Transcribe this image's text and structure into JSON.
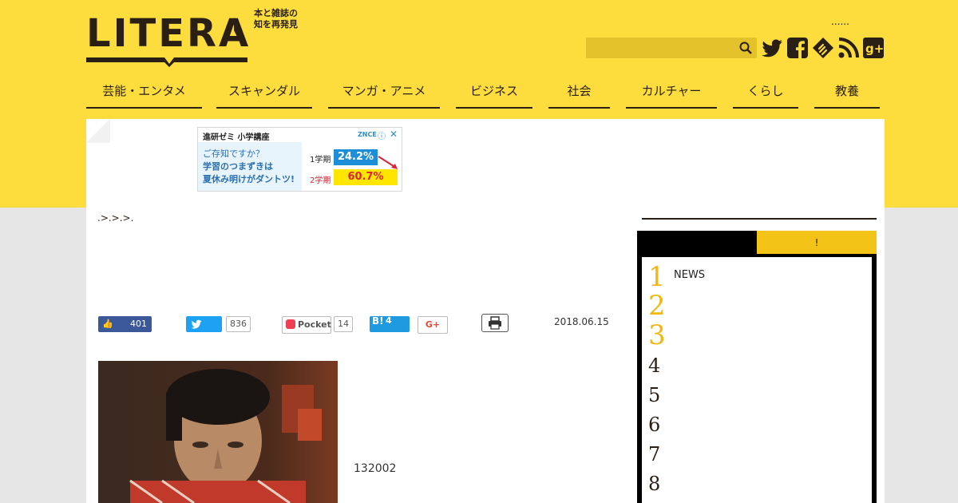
{
  "header": {
    "logo_text": "LITERA",
    "tagline_line1": "本と雑誌の",
    "tagline_line2": "知を再発見",
    "dots": "......",
    "search": {
      "placeholder": ""
    },
    "social_icons": [
      "twitter-icon",
      "facebook-icon",
      "feedly-icon",
      "rss-icon",
      "google-plus-icon"
    ]
  },
  "nav": [
    {
      "label": "芸能・エンタメ"
    },
    {
      "label": "スキャンダル"
    },
    {
      "label": "マンガ・アニメ"
    },
    {
      "label": "ビジネス"
    },
    {
      "label": "社会"
    },
    {
      "label": "カルチャー"
    },
    {
      "label": "くらし"
    },
    {
      "label": "教養"
    }
  ],
  "ad": {
    "title": "進研ゼミ 小学講座",
    "line1": "ご存知ですか？",
    "line2": "学習のつまずきは",
    "line3": "夏休み明けがダントツ!",
    "term1": "1学期",
    "value1": "24.2%",
    "term2": "2学期",
    "value2": "60.7%",
    "brand": "ZNCE"
  },
  "breadcrumb": ".>.>.>.",
  "share": {
    "like_count": "401",
    "tweet_count": "836",
    "pocket_label": "Pocket",
    "pocket_count": "14",
    "hatena_label": "B!",
    "hatena_count": "4",
    "gplus_label": "G+"
  },
  "article": {
    "date": "2018.06.15",
    "caption": "132002"
  },
  "sidebar": {
    "tab_a": "",
    "tab_b": "!",
    "ranking": [
      {
        "rank": "1",
        "label": "NEWS"
      },
      {
        "rank": "2",
        "label": ""
      },
      {
        "rank": "3",
        "label": ""
      },
      {
        "rank": "4",
        "label": ""
      },
      {
        "rank": "5",
        "label": ""
      },
      {
        "rank": "6",
        "label": ""
      },
      {
        "rank": "7",
        "label": ""
      },
      {
        "rank": "8",
        "label": ""
      }
    ]
  },
  "colors": {
    "brand_yellow": "#fddc3e",
    "gold": "#f0b811",
    "ink": "#2a1f14"
  }
}
